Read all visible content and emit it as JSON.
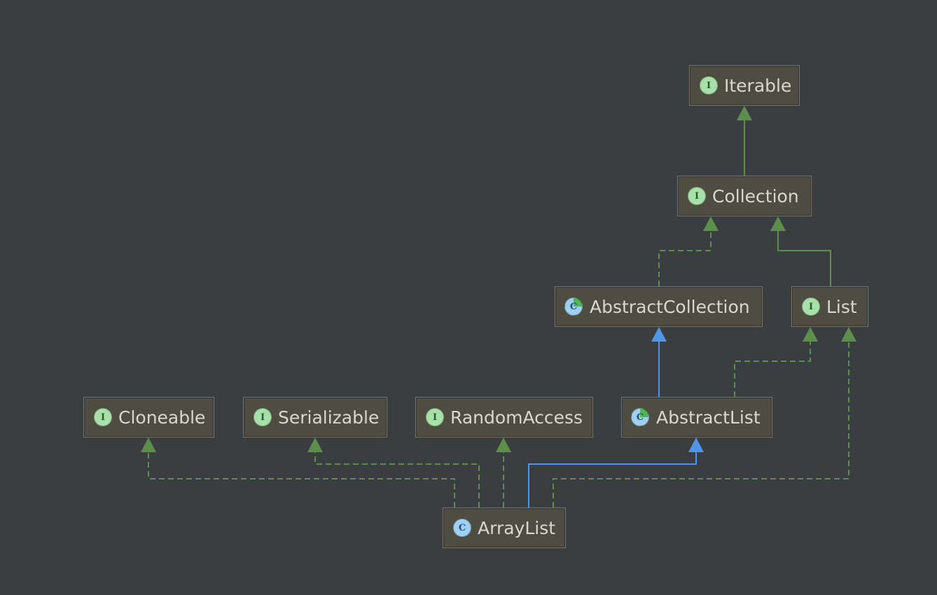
{
  "diagram": {
    "nodes": {
      "iterable": {
        "label": "Iterable",
        "badge": "I",
        "kind": "interface"
      },
      "collection": {
        "label": "Collection",
        "badge": "I",
        "kind": "interface"
      },
      "abstract_collection": {
        "label": "AbstractCollection",
        "badge": "C",
        "kind": "abstract-class"
      },
      "list": {
        "label": "List",
        "badge": "I",
        "kind": "interface"
      },
      "cloneable": {
        "label": "Cloneable",
        "badge": "I",
        "kind": "interface"
      },
      "serializable": {
        "label": "Serializable",
        "badge": "I",
        "kind": "interface"
      },
      "random_access": {
        "label": "RandomAccess",
        "badge": "I",
        "kind": "interface"
      },
      "abstract_list": {
        "label": "AbstractList",
        "badge": "C",
        "kind": "abstract-class"
      },
      "array_list": {
        "label": "ArrayList",
        "badge": "C",
        "kind": "class"
      }
    },
    "colors": {
      "background": "#3b3e41",
      "node_fill": "#4f4c42",
      "implements_edge": "#5d8f4c",
      "extends_edge": "#4f95e8",
      "interface_icon": "#a7e0a8",
      "class_icon": "#9fcff1"
    }
  }
}
